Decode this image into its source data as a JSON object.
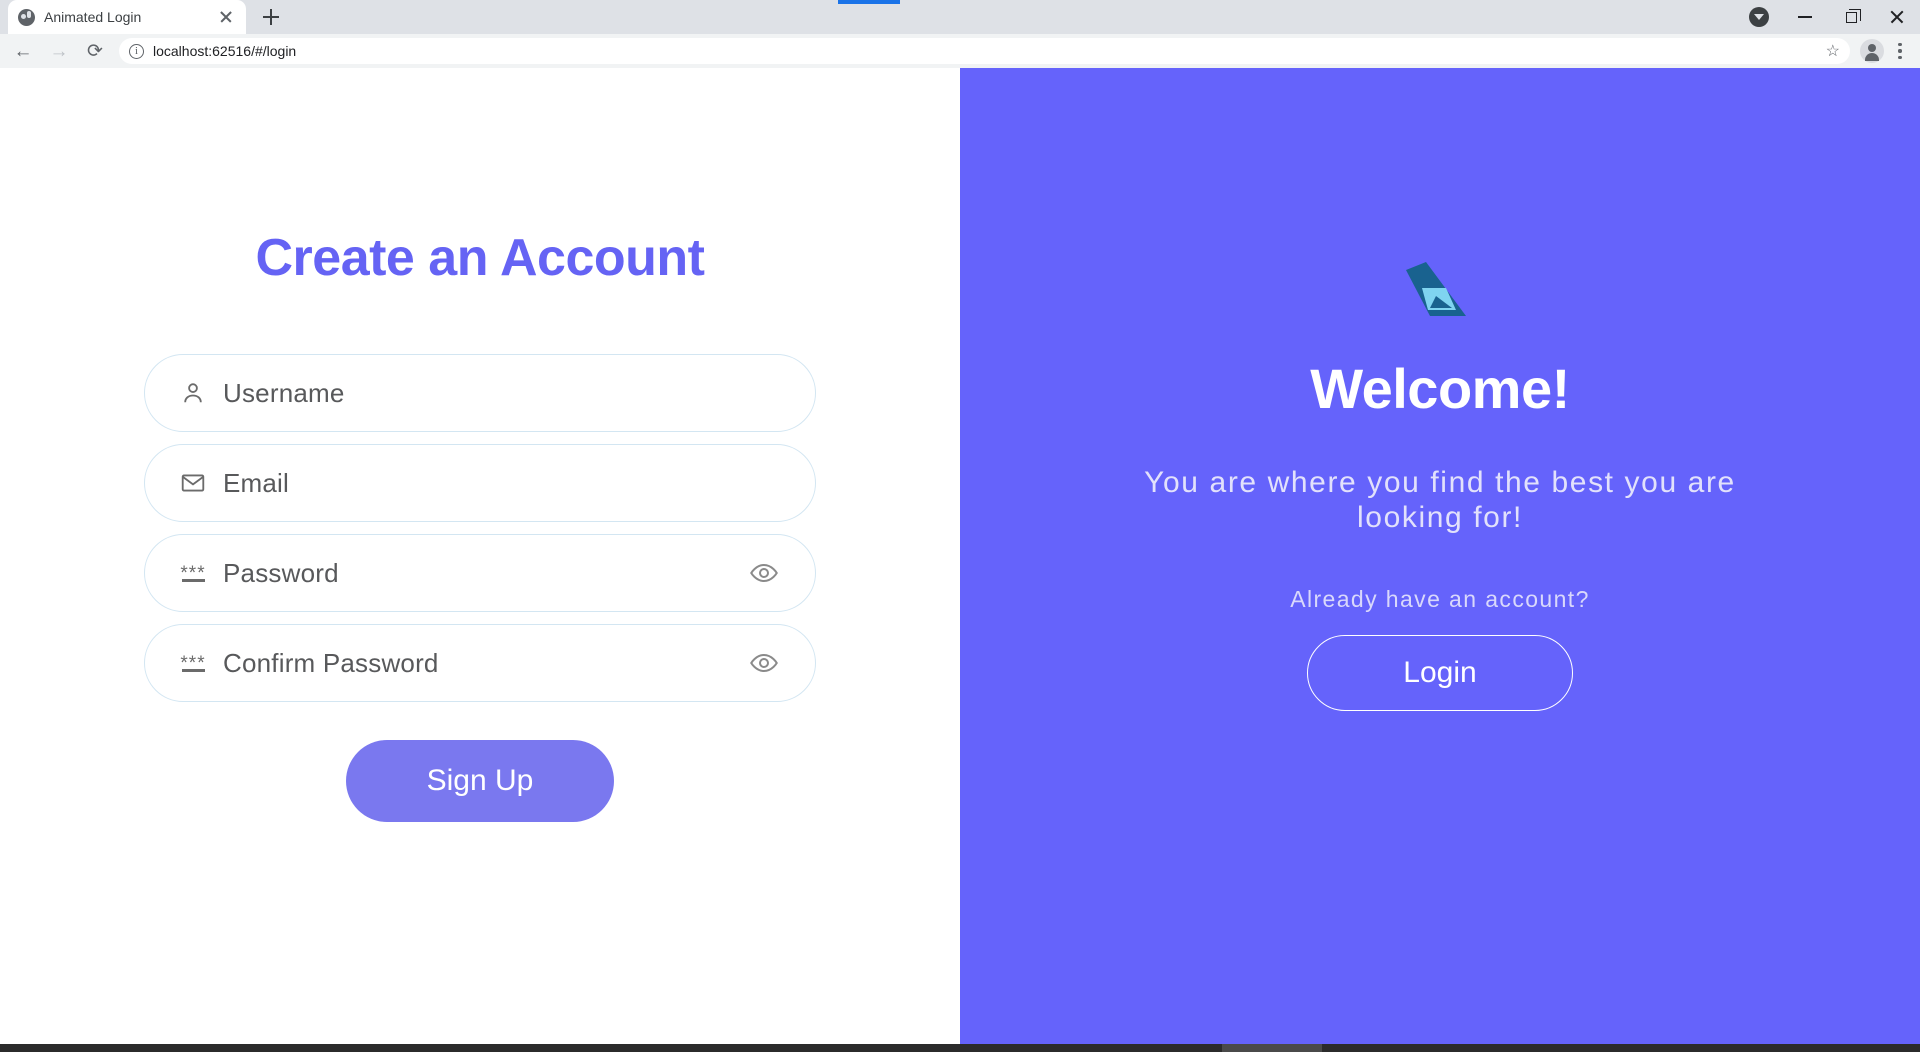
{
  "browser": {
    "tab": {
      "title": "Animated Login",
      "favicon_name": "globe-icon",
      "close_label": "×"
    },
    "new_tab_label": "+",
    "window_controls": {
      "profile_label": "▼",
      "minimize_label": "─",
      "maximize_label": "❐",
      "close_label": "×"
    },
    "toolbar": {
      "back_label": "←",
      "forward_label": "→",
      "reload_label": "⟳",
      "info_label": "i",
      "url": "localhost:62516/#/login",
      "bookmark_label": "☆",
      "menu_label": "⋮"
    }
  },
  "signup": {
    "title": "Create an Account",
    "fields": [
      {
        "name": "username",
        "placeholder": "Username",
        "icon": "person-icon",
        "has_toggle": false
      },
      {
        "name": "email",
        "placeholder": "Email",
        "icon": "envelope-icon",
        "has_toggle": false
      },
      {
        "name": "password",
        "placeholder": "Password",
        "icon": "password-asterisk-icon",
        "has_toggle": true
      },
      {
        "name": "confirm_password",
        "placeholder": "Confirm Password",
        "icon": "password-asterisk-icon",
        "has_toggle": true
      }
    ],
    "submit_label": "Sign Up"
  },
  "welcome": {
    "logo_name": "brand-logo-icon",
    "title": "Welcome!",
    "subtitle": "You are where you find the best you are looking for!",
    "account_prompt": "Already have an account?",
    "login_label": "Login"
  },
  "colors": {
    "accent_purple": "#6563f4",
    "panel_purple": "#6563fb",
    "button_purple": "#7a78ef",
    "field_border": "#d3e6f2",
    "logo_dark": "#19628f",
    "logo_light": "#7fd4f0"
  }
}
